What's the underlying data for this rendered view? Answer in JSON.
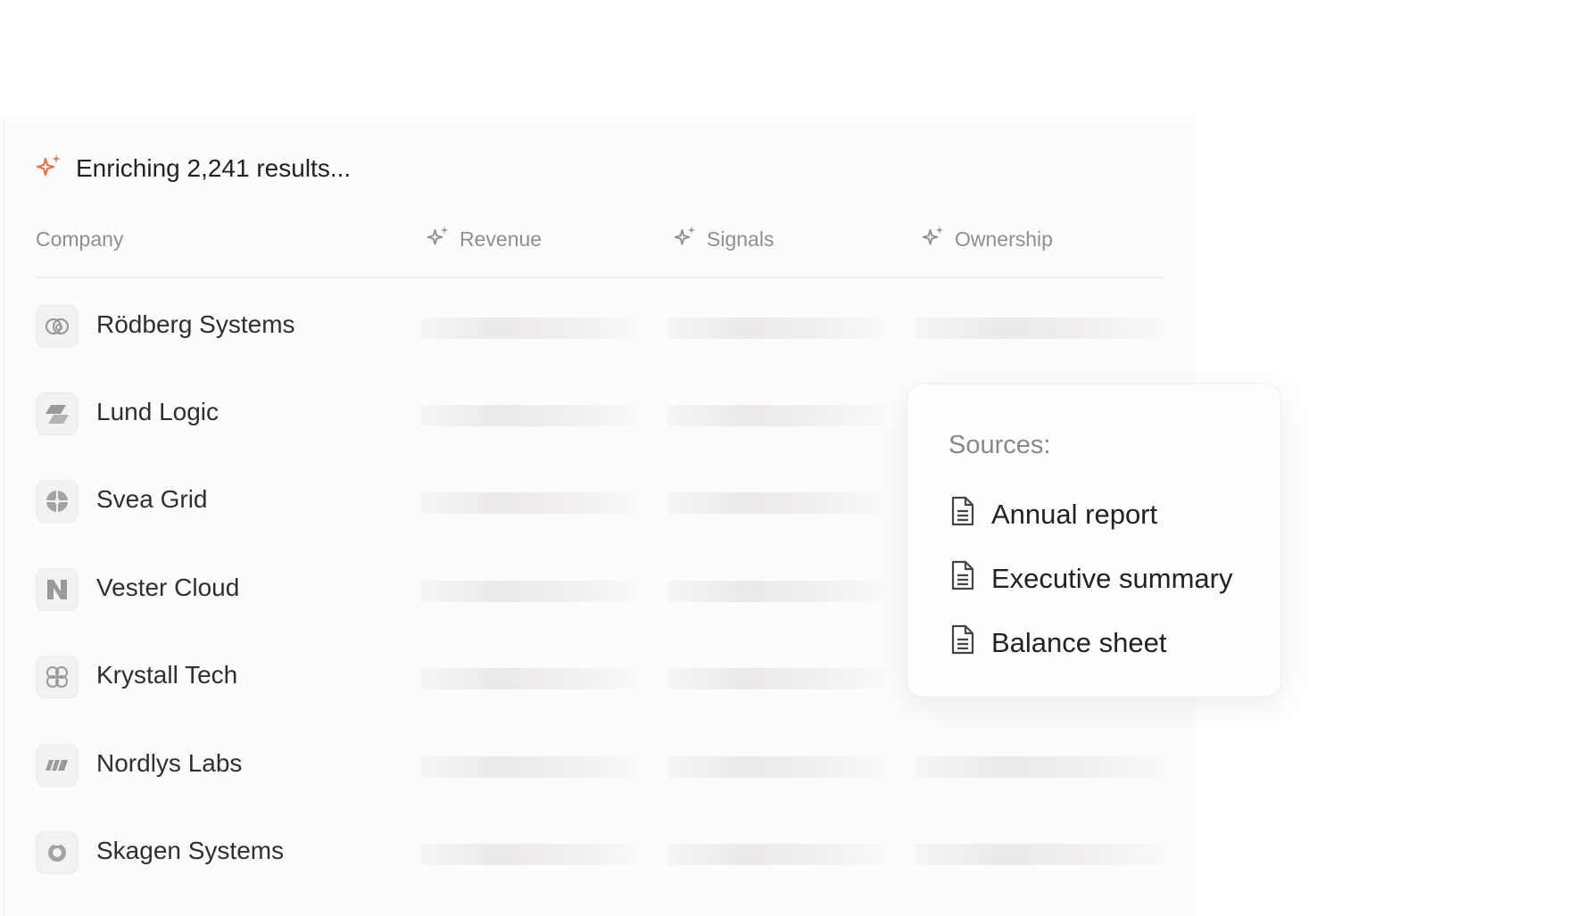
{
  "status": {
    "text": "Enriching 2,241 results...",
    "accent": "#f0704c"
  },
  "columns": [
    {
      "label": "Company",
      "icon": ""
    },
    {
      "label": "Revenue",
      "icon": "sparkle-icon"
    },
    {
      "label": "Signals",
      "icon": "sparkle-icon"
    },
    {
      "label": "Ownership",
      "icon": "sparkle-icon"
    }
  ],
  "rows": [
    {
      "company": "Rödberg Systems",
      "logo": "interlocking-rings-logo"
    },
    {
      "company": "Lund Logic",
      "logo": "slanted-bars-logo"
    },
    {
      "company": "Svea Grid",
      "logo": "circle-grid-logo"
    },
    {
      "company": "Vester Cloud",
      "logo": "n-letter-logo"
    },
    {
      "company": "Krystall Tech",
      "logo": "petal-logo"
    },
    {
      "company": "Nordlys Labs",
      "logo": "stripes-logo"
    },
    {
      "company": "Skagen Systems",
      "logo": "ring-logo"
    }
  ],
  "popup": {
    "label": "Sources:",
    "items": [
      "Annual report",
      "Executive summary",
      "Balance sheet"
    ]
  }
}
